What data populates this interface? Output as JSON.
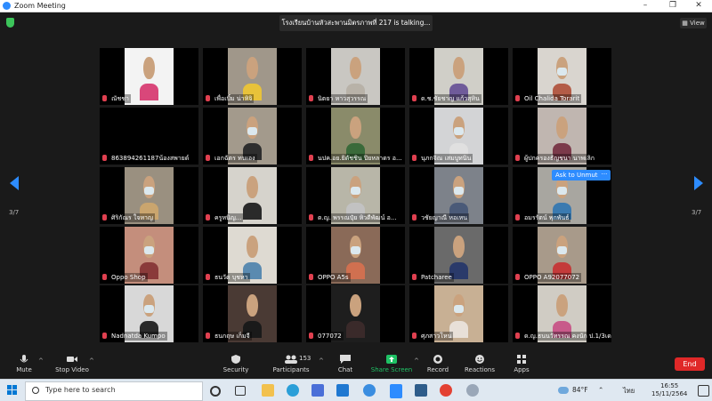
{
  "window": {
    "title": "Zoom Meeting"
  },
  "talking_banner": "โรงเรียนบ้านหัวสะพานมิตรภาพที่ 217 is  talking...",
  "view_button": "View",
  "page_left": "3/7",
  "page_right": "3/7",
  "ask_to_unmute": "Ask to Unmute",
  "more_dots": "···",
  "participants": [
    {
      "name": "ณัชชา",
      "bg": "#f3f3f3",
      "shirt": "#d9477a",
      "mask": false
    },
    {
      "name": "เพื่อเบิ้ม น่าหิจิ",
      "bg": "#a0978a",
      "shirt": "#e8c23a",
      "mask": false
    },
    {
      "name": "นิตยา หาวสุวรรณ",
      "bg": "#c9c7c2",
      "shirt": "#b8b2a8",
      "mask": false
    },
    {
      "name": "ด.ช.ชัยชาญ แก้วสุหิน",
      "bg": "#d0cfc8",
      "shirt": "#6f5b9a",
      "mask": false
    },
    {
      "name": "Oil Chalida Torarit",
      "bg": "#d9d5cf",
      "shirt": "#b35c47",
      "mask": true
    },
    {
      "name": "863894261187น้องสพายด์",
      "bg": "#000000",
      "shirt": "#000000",
      "mask": false,
      "empty": true
    },
    {
      "name": "เอกฉัตร ทนเอง",
      "bg": "#a39a8c",
      "shirt": "#2e2e2e",
      "mask": true
    },
    {
      "name": "นปค.อย.ยิดัชชิน ปิยหลาดร อ...",
      "bg": "#8a8b6a",
      "shirt": "#3a6a3a",
      "mask": false
    },
    {
      "name": "นุภกจิณ เสมบูทนิน",
      "bg": "#d3d4d6",
      "shirt": "#e0e0e0",
      "mask": true
    },
    {
      "name": "ผู้ปกครองธัญชนา นาพเลิก",
      "bg": "#c0b6b0",
      "shirt": "#7b3a4a",
      "mask": false
    },
    {
      "name": "ศิริกัณร ใจหาญ",
      "bg": "#9a9080",
      "shirt": "#caa56e",
      "mask": true
    },
    {
      "name": "ครูหนิญ...",
      "bg": "#d6d3cc",
      "shirt": "#2a2a2a",
      "mask": false
    },
    {
      "name": "ด.ญ. พรรณปุ๋ย หิวดีพัฒน์ อ...",
      "bg": "#b8b6a8",
      "shirt": "#c2c2c2",
      "mask": true
    },
    {
      "name": "วชัยญาณี หอเหน",
      "bg": "#7d828a",
      "shirt": "#4a5a78",
      "mask": true
    },
    {
      "name": "อมรรัตน์ พุกพันธ์",
      "bg": "#a8a6a0",
      "shirt": "#3a7ab0",
      "mask": true
    },
    {
      "name": "Oppo Shop",
      "bg": "#c48e7c",
      "shirt": "#8a3a3a",
      "mask": true
    },
    {
      "name": "ธนวัต บุชหา",
      "bg": "#dedad2",
      "shirt": "#5a8ab0",
      "mask": false
    },
    {
      "name": "OPPO A5s",
      "bg": "#8a6a58",
      "shirt": "#d07050",
      "mask": true
    },
    {
      "name": "Patcharee",
      "bg": "#6a6a6a",
      "shirt": "#2a3a6a",
      "mask": false
    },
    {
      "name": "OPPO A92077072",
      "bg": "#a89a8a",
      "shirt": "#c43a3a",
      "mask": true
    },
    {
      "name": "Nadnatda Kumpo",
      "bg": "#d8d8d8",
      "shirt": "#2a2a2a",
      "mask": true
    },
    {
      "name": "ธนกฤษ เก็มจี",
      "bg": "#4a3a34",
      "shirt": "#1a1a1a",
      "mask": false
    },
    {
      "name": "077072",
      "bg": "#1e1e1e",
      "shirt": "#3a2a2a",
      "mask": false
    },
    {
      "name": "ศุภสาวโหน",
      "bg": "#c8b094",
      "shirt": "#e8e0d8",
      "mask": true
    },
    {
      "name": "ด.ญ.ธนนวัทรรณ คงนัก ป.1/3เด...",
      "bg": "#d0ccc4",
      "shirt": "#c85a8a",
      "mask": false
    }
  ],
  "toolbar": {
    "mute": "Mute",
    "stop_video": "Stop Video",
    "security": "Security",
    "participants": "Participants",
    "participants_count": "153",
    "chat": "Chat",
    "share_screen": "Share Screen",
    "record": "Record",
    "reactions": "Reactions",
    "apps": "Apps",
    "end": "End",
    "caret": "^"
  },
  "taskbar": {
    "search_placeholder": "Type here to search",
    "weather": "84°F",
    "lang": "ไทย",
    "time": "16:55",
    "date": "15/11/2564"
  },
  "colors": {
    "accent": "#2d8cff",
    "end": "#e02828",
    "share": "#1fc265"
  }
}
